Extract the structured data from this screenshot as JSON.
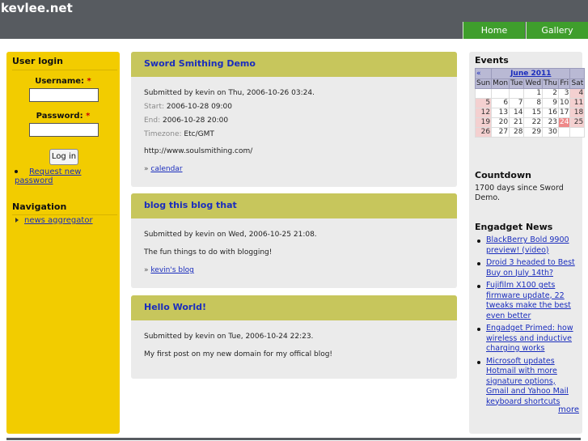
{
  "header": {
    "site_name": "kevlee.net",
    "nav": [
      {
        "label": "Home"
      },
      {
        "label": "Gallery"
      }
    ]
  },
  "left_sidebar": {
    "user_login": {
      "title": "User login",
      "username_label": "Username:",
      "password_label": "Password:",
      "required_marker": "*",
      "username_value": "",
      "password_value": "",
      "login_button": "Log in",
      "request_password_link": "Request new password"
    },
    "navigation": {
      "title": "Navigation",
      "items": [
        {
          "label": "news aggregator"
        }
      ]
    }
  },
  "main": {
    "nodes": [
      {
        "title": "Sword Smithing Demo",
        "submitted": "Submitted by kevin on Thu, 2006-10-26 03:24.",
        "start_label": "Start:",
        "start_value": "2006-10-28 09:00",
        "end_label": "End:",
        "end_value": "2006-10-28 20:00",
        "timezone_label": "Timezone:",
        "timezone_value": "Etc/GMT",
        "body": "http://www.soulsmithing.com/",
        "link_prefix": "»",
        "link_label": "calendar"
      },
      {
        "title": "blog this blog that",
        "submitted": "Submitted by kevin on Wed, 2006-10-25 21:08.",
        "body": "The fun things to do with blogging!",
        "link_prefix": "»",
        "link_label": "kevin's blog"
      },
      {
        "title": "Hello World!",
        "submitted": "Submitted by kevin on Tue, 2006-10-24 22:23.",
        "body": "My first post on my new domain for my offical blog!"
      }
    ]
  },
  "right_sidebar": {
    "events": {
      "title": "Events",
      "calendar": {
        "prev_label": "«",
        "month_label": "June 2011",
        "days": [
          "Sun",
          "Mon",
          "Tue",
          "Wed",
          "Thu",
          "Fri",
          "Sat"
        ],
        "weeks": [
          [
            "",
            "",
            "",
            "1",
            "2",
            "3",
            "4"
          ],
          [
            "5",
            "6",
            "7",
            "8",
            "9",
            "10",
            "11"
          ],
          [
            "12",
            "13",
            "14",
            "15",
            "16",
            "17",
            "18"
          ],
          [
            "19",
            "20",
            "21",
            "22",
            "23",
            "24",
            "25"
          ],
          [
            "26",
            "27",
            "28",
            "29",
            "30",
            "",
            ""
          ]
        ],
        "today": "24"
      }
    },
    "countdown": {
      "title": "Countdown",
      "text": "1700 days since Sword Demo."
    },
    "engadget": {
      "title": "Engadget News",
      "items": [
        "BlackBerry Bold 9900 preview! (video)",
        "Droid 3 headed to Best Buy on July 14th?",
        "Fujifilm X100 gets firmware update, 22 tweaks make the best even better",
        "Engadget Primed: how wireless and inductive charging works",
        "Microsoft updates Hotmail with more signature options, Gmail and Yahoo Mail keyboard shortcuts"
      ],
      "more_label": "more"
    }
  },
  "colors": {
    "header_bg": "#575b60",
    "nav_green": "#3f9e2c",
    "left_sidebar_yellow": "#f2cc00",
    "node_header_olive": "#c7c65c",
    "node_body_grey": "#ebebeb",
    "link_blue": "#1a2dbd"
  }
}
